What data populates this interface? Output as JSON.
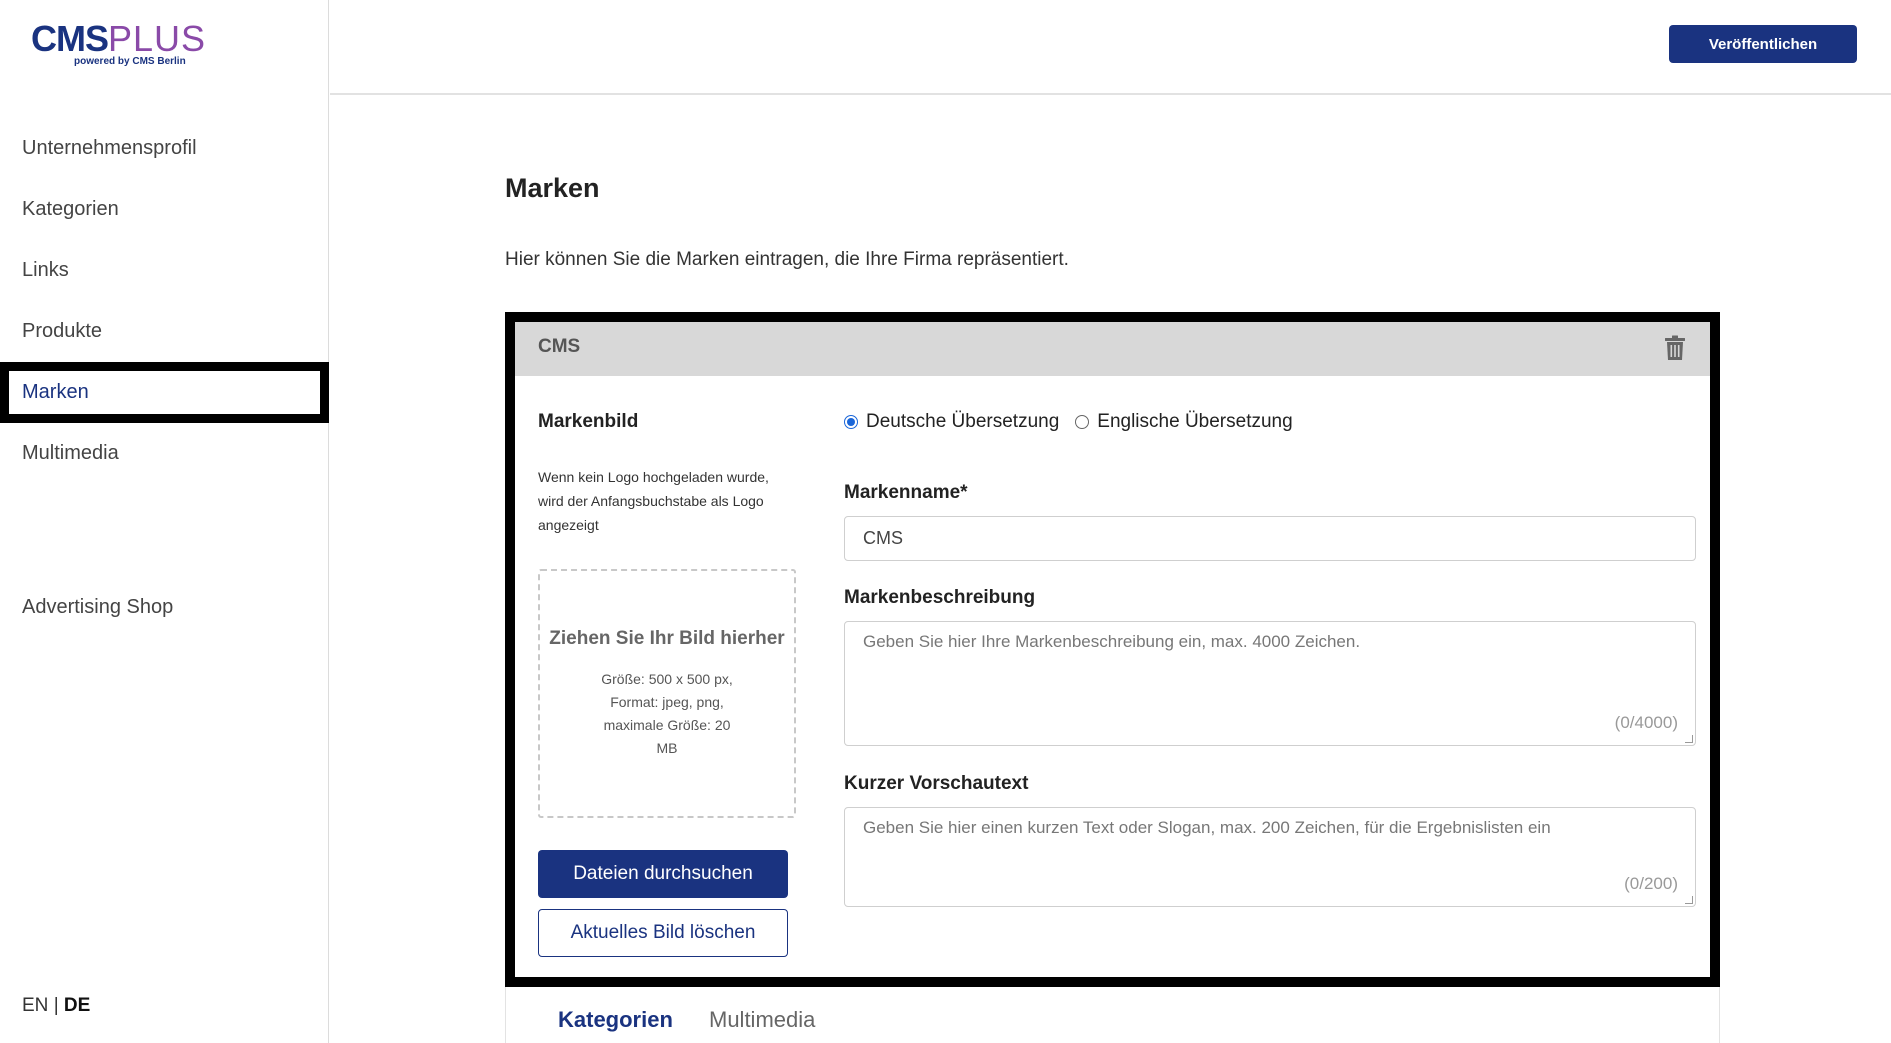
{
  "logo": {
    "main_a": "CMS",
    "main_b": "PLUS",
    "sub": "powered by CMS Berlin"
  },
  "sidebar": {
    "items": [
      {
        "label": "Unternehmensprofil"
      },
      {
        "label": "Kategorien"
      },
      {
        "label": "Links"
      },
      {
        "label": "Produkte"
      },
      {
        "label": "Marken"
      },
      {
        "label": "Multimedia"
      }
    ],
    "active": "Marken",
    "advertising": "Advertising Shop",
    "lang_en": "EN",
    "lang_sep": "|",
    "lang_de": "DE"
  },
  "topbar": {
    "publish_label": "Veröffentlichen"
  },
  "page": {
    "title": "Marken",
    "intro": "Hier können Sie die Marken eintragen, die Ihre Firma repräsentiert."
  },
  "card": {
    "title": "CMS",
    "markenbild_title": "Markenbild",
    "markenbild_note": "Wenn kein Logo hochgeladen wurde, wird der Anfangsbuchstabe als Logo angezeigt",
    "dropzone_title": "Ziehen Sie Ihr Bild hierher",
    "dropzone_info": "Größe: 500 x 500 px, Format: jpeg, png, maximale Größe: 20 MB",
    "browse_label": "Dateien durchsuchen",
    "delete_image_label": "Aktuelles Bild löschen",
    "radio_de": "Deutsche Übersetzung",
    "radio_en": "Englische Übersetzung",
    "radio_selected": "de",
    "name_label": "Markenname*",
    "name_value": "CMS",
    "desc_label": "Markenbeschreibung",
    "desc_placeholder": "Geben Sie hier Ihre Markenbeschreibung ein, max. 4000 Zeichen.",
    "desc_count": "(0/4000)",
    "short_label": "Kurzer Vorschautext",
    "short_placeholder": "Geben Sie hier einen kurzen Text oder Slogan, max. 200 Zeichen, für die Ergebnislisten ein",
    "short_count": "(0/200)"
  },
  "tabs": [
    {
      "label": "Kategorien",
      "active": true
    },
    {
      "label": "Multimedia",
      "active": false
    }
  ],
  "colors": {
    "primary": "#1a3380",
    "accent": "#8a4aa8",
    "radio": "#1a66d9"
  }
}
